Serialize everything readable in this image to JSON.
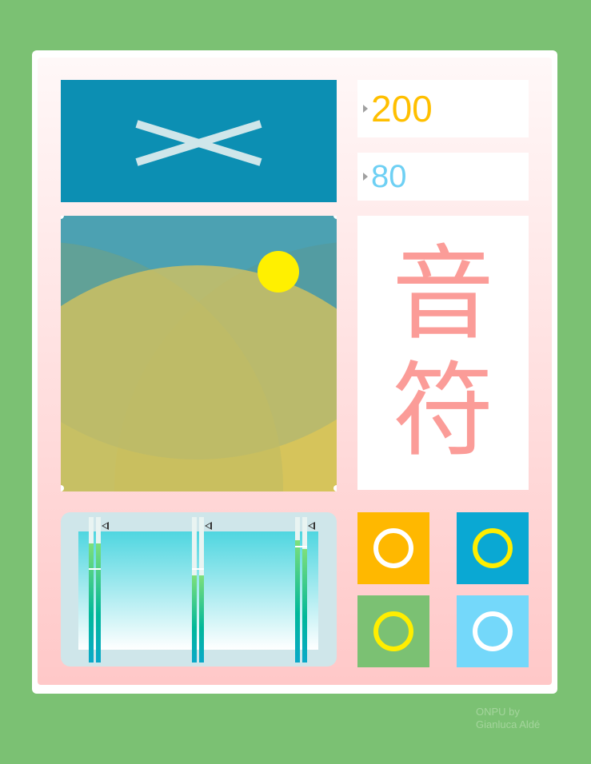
{
  "values": {
    "first": "200",
    "second": "80"
  },
  "title": {
    "char1": "音",
    "char2": "符"
  },
  "meters": [
    {
      "level_left": 0.82,
      "level_right": 0.82,
      "peak": 0.65
    },
    {
      "level_left": 0.6,
      "level_right": 0.6,
      "peak": 0.65
    },
    {
      "level_left": 0.84,
      "level_right": 0.78,
      "peak": 0.8
    }
  ],
  "buttons": [
    {
      "name": "orange",
      "bg": "#ffb800",
      "ring": "#ffffff"
    },
    {
      "name": "blue",
      "bg": "#0aa8d3",
      "ring": "#ffee00"
    },
    {
      "name": "green",
      "bg": "#7bc173",
      "ring": "#ffee00"
    },
    {
      "name": "lightblue",
      "bg": "#74d8fa",
      "ring": "#ffffff"
    }
  ],
  "colors": {
    "background": "#7bc173",
    "mode_tile": "#0c8fb3",
    "value_orange": "#ffbf00",
    "value_blue": "#6ed0f4",
    "title_pink": "#fb9c98",
    "sun_yellow": "#fff000"
  },
  "credit": {
    "line1": "ONPU by",
    "line2": "Gianluca Aldé"
  }
}
